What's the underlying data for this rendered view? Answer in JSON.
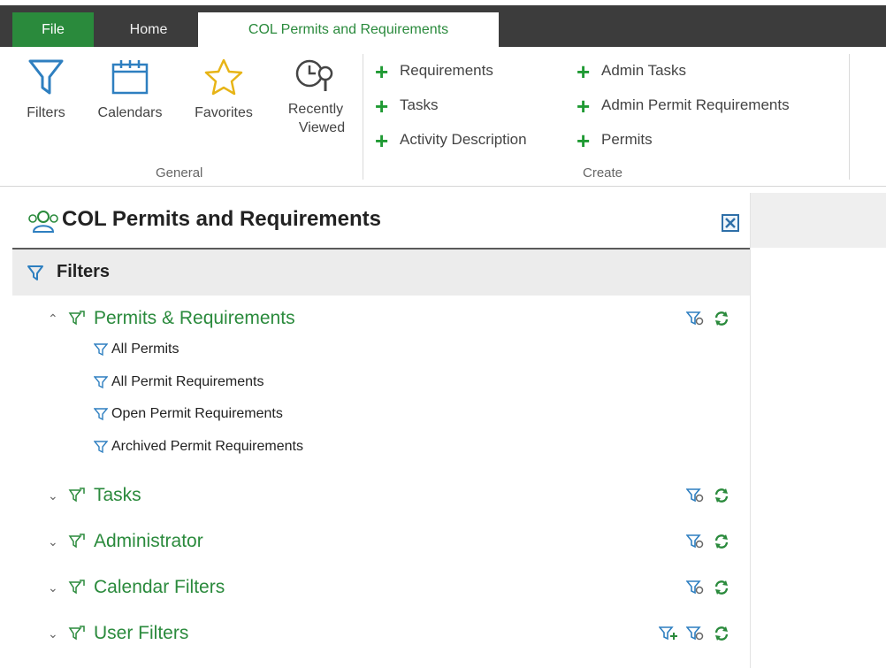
{
  "tabs": {
    "file": "File",
    "home": "Home",
    "active": "COL Permits and Requirements"
  },
  "ribbon": {
    "general": {
      "label": "General",
      "buttons": {
        "filters": "Filters",
        "calendars": "Calendars",
        "favorites": "Favorites",
        "recently_1": "Recently",
        "recently_2": "Viewed"
      }
    },
    "create": {
      "label": "Create",
      "items": {
        "requirements": "Requirements",
        "tasks": "Tasks",
        "activity": "Activity Description",
        "admin_tasks": "Admin Tasks",
        "admin_permit_req": "Admin Permit Requirements",
        "permits": "Permits"
      }
    }
  },
  "panel": {
    "title": "COL Permits and Requirements",
    "filters_label": "Filters",
    "sections": {
      "permits": {
        "name": "Permits & Requirements",
        "items": [
          "All Permits",
          "All Permit Requirements",
          "Open Permit Requirements",
          "Archived Permit Requirements"
        ]
      },
      "tasks": {
        "name": "Tasks"
      },
      "admin": {
        "name": "Administrator"
      },
      "calendar": {
        "name": "Calendar Filters"
      },
      "user": {
        "name": "User Filters"
      }
    }
  },
  "colors": {
    "accent_green": "#2a8a3c",
    "icon_blue": "#2e7fc0",
    "tab_bar": "#3c3c3c"
  }
}
